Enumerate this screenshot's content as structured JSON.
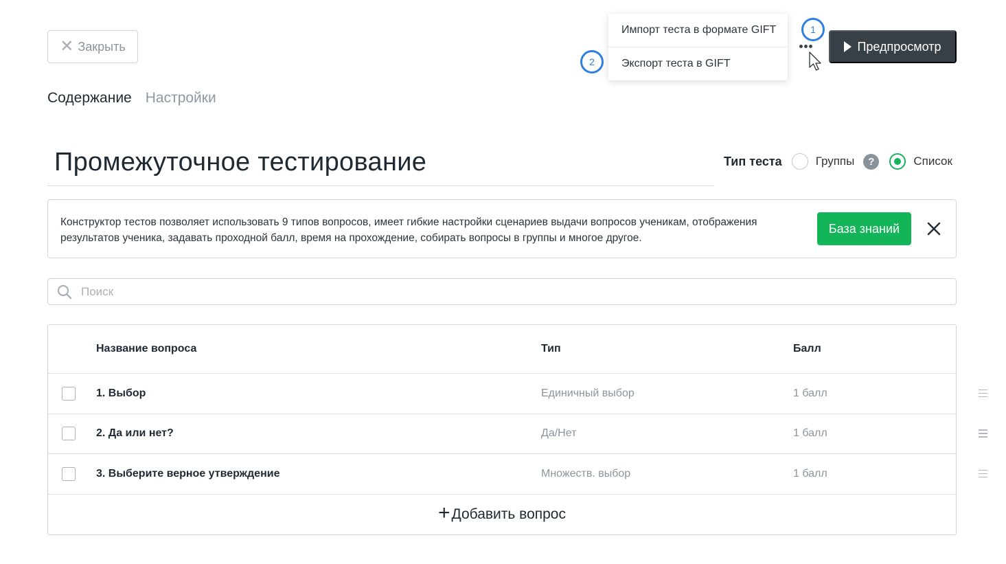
{
  "header": {
    "close_label": "Закрыть",
    "preview_label": "Предпросмотр"
  },
  "tabs": [
    {
      "label": "Содержание",
      "active": true
    },
    {
      "label": "Настройки",
      "active": false
    }
  ],
  "more_menu": {
    "items": [
      {
        "label": "Импорт теста в формате GIFT"
      },
      {
        "label": "Экспорт теста в GIFT"
      }
    ],
    "callouts": [
      "1",
      "2"
    ]
  },
  "test": {
    "title": "Промежуточное тестирование",
    "type_label": "Тип теста",
    "type_options": [
      {
        "label": "Группы",
        "selected": false
      },
      {
        "label": "Список",
        "selected": true
      }
    ],
    "help_icon": "?"
  },
  "info": {
    "text": "Конструктор тестов позволяет использовать 9 типов вопросов, имеет гибкие настройки сценариев выдачи вопросов ученикам, отображения результатов ученика, задавать проходной балл, время на прохождение, собирать вопросы в группы и многое другое.",
    "button_label": "База знаний"
  },
  "search": {
    "placeholder": "Поиск",
    "value": ""
  },
  "table": {
    "columns": [
      "Название вопроса",
      "Тип",
      "Балл"
    ],
    "rows": [
      {
        "name": "1. Выбор",
        "type": "Единичный выбор",
        "score": "1 балл"
      },
      {
        "name": "2. Да или нет?",
        "type": "Да/Нет",
        "score": "1 балл"
      },
      {
        "name": "3. Выберите верное утверждение",
        "type": "Множеств. выбор",
        "score": "1 балл"
      }
    ],
    "add_label": "Добавить вопрос"
  },
  "colors": {
    "accent_green": "#14b458",
    "dark_button": "#373f47",
    "callout_blue": "#2e7fe0"
  }
}
